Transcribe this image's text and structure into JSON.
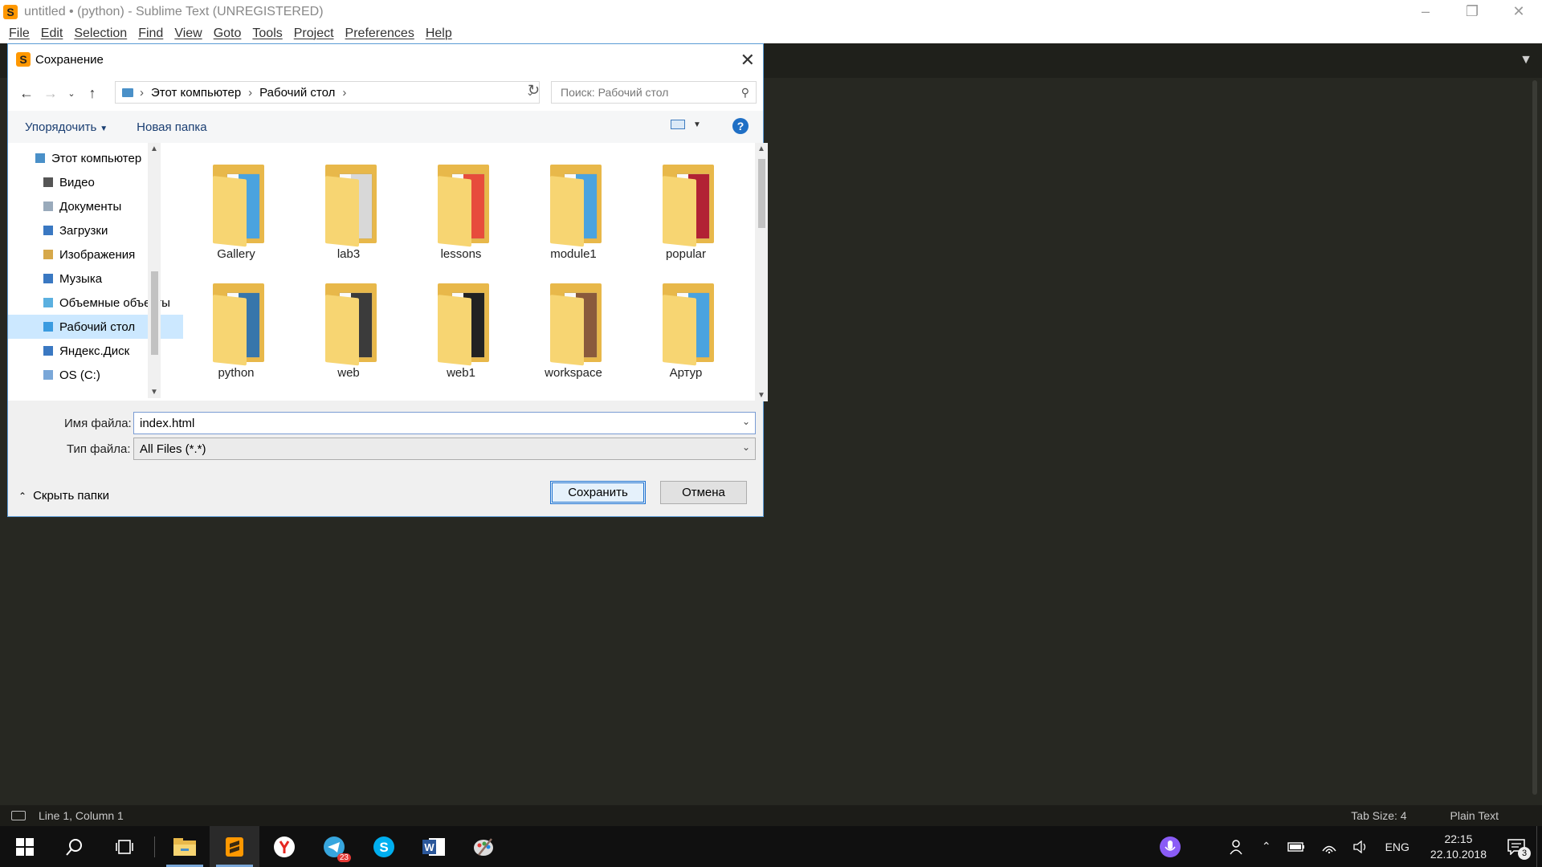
{
  "window": {
    "title": "untitled • (python) - Sublime Text (UNREGISTERED)",
    "menu": [
      "File",
      "Edit",
      "Selection",
      "Find",
      "View",
      "Goto",
      "Tools",
      "Project",
      "Preferences",
      "Help"
    ]
  },
  "status_bar": {
    "position": "Line 1, Column 1",
    "tab_size": "Tab Size: 4",
    "syntax": "Plain Text"
  },
  "dialog": {
    "title": "Сохранение",
    "breadcrumb": [
      "Этот компьютер",
      "Рабочий стол"
    ],
    "search_placeholder": "Поиск: Рабочий стол",
    "organize_label": "Упорядочить",
    "new_folder_label": "Новая папка",
    "help_glyph": "?",
    "nav_items": [
      {
        "label": "Этот компьютер",
        "icon": "computer-icon",
        "indent": 1
      },
      {
        "label": "Видео",
        "icon": "video-folder-icon",
        "indent": 2
      },
      {
        "label": "Документы",
        "icon": "documents-folder-icon",
        "indent": 2
      },
      {
        "label": "Загрузки",
        "icon": "downloads-folder-icon",
        "indent": 2
      },
      {
        "label": "Изображения",
        "icon": "pictures-folder-icon",
        "indent": 2
      },
      {
        "label": "Музыка",
        "icon": "music-folder-icon",
        "indent": 2
      },
      {
        "label": "Объемные объекты",
        "icon": "3d-objects-folder-icon",
        "indent": 2
      },
      {
        "label": "Рабочий стол",
        "icon": "desktop-folder-icon",
        "indent": 2,
        "selected": true
      },
      {
        "label": "Яндекс.Диск",
        "icon": "yandex-disk-icon",
        "indent": 2
      },
      {
        "label": "OS (C:)",
        "icon": "drive-icon",
        "indent": 2
      }
    ],
    "files": [
      {
        "name": "Gallery",
        "paper_color": "#4aa3df"
      },
      {
        "name": "lab3",
        "paper_color": "#d8d8d8"
      },
      {
        "name": "lessons",
        "paper_color": "#e74c3c"
      },
      {
        "name": "module1",
        "paper_color": "#4aa3df"
      },
      {
        "name": "popular",
        "paper_color": "#b22234"
      },
      {
        "name": "python",
        "paper_color": "#3776ab"
      },
      {
        "name": "web",
        "paper_color": "#3b3b3b"
      },
      {
        "name": "web1",
        "paper_color": "#222222"
      },
      {
        "name": "workspace",
        "paper_color": "#8a5a3c"
      },
      {
        "name": "Артур",
        "paper_color": "#4aa3df"
      }
    ],
    "filename_label": "Имя файла:",
    "filename_value": "index.html",
    "filetype_label": "Тип файла:",
    "filetype_value": "All Files (*.*)",
    "hide_folders_label": "Скрыть папки",
    "save_label": "Сохранить",
    "cancel_label": "Отмена"
  },
  "taskbar": {
    "apps": [
      "start-icon",
      "search-icon",
      "task-view-icon",
      "file-explorer-icon",
      "sublime-text-icon",
      "yandex-browser-icon",
      "telegram-icon",
      "skype-icon",
      "word-icon",
      "paint-icon"
    ],
    "telegram_badge": "23",
    "language": "ENG",
    "time": "22:15",
    "date": "22.10.2018",
    "notification_count": "3"
  },
  "colors": {
    "editor_bg": "#272822",
    "dialog_border": "#5b9bd5",
    "selection": "#cce8ff",
    "accent": "#ff9800"
  }
}
